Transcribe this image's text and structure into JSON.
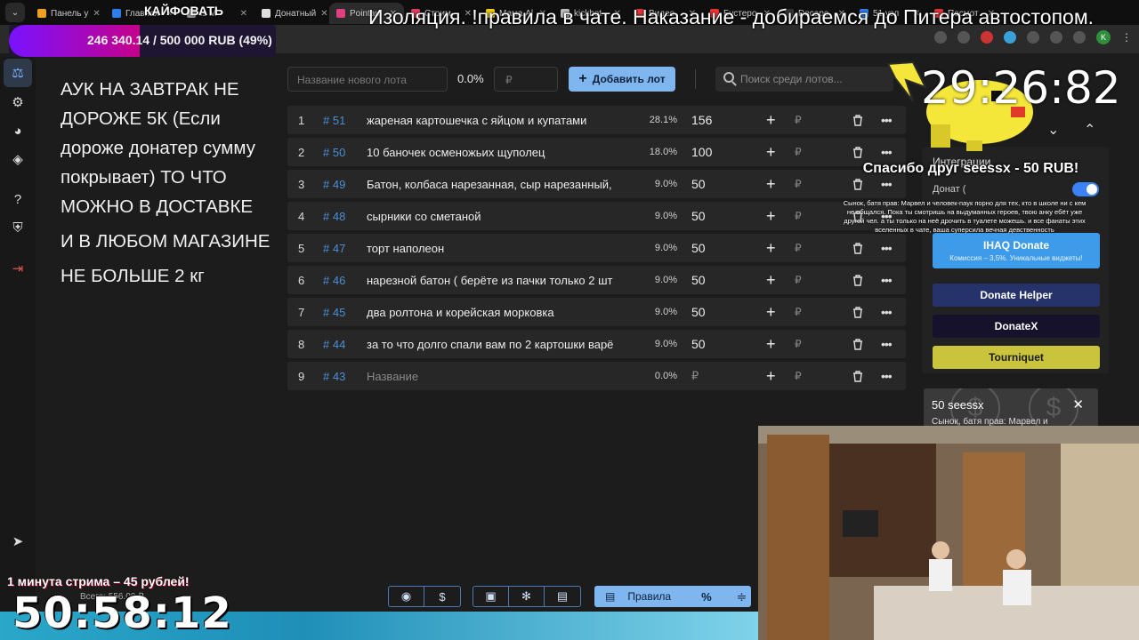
{
  "tabs": [
    {
      "label": "Панель у",
      "color": "#f0a020"
    },
    {
      "label": "Главная",
      "color": "#2b7de9"
    },
    {
      "label": "is M",
      "color": "#999999"
    },
    {
      "label": "Донатный",
      "color": "#dddddd"
    },
    {
      "label": "Pointau",
      "color": "#e04080",
      "active": true
    },
    {
      "label": "Стрим",
      "color": "#e33b5a"
    },
    {
      "label": "Мама Аl",
      "color": "#f2c811"
    },
    {
      "label": "kickbot",
      "color": "#bbbbbb"
    },
    {
      "label": "Видео",
      "color": "#d33"
    },
    {
      "label": "Бустеро",
      "color": "#e33"
    },
    {
      "label": "Decapo",
      "color": "#333"
    },
    {
      "label": "51 узл",
      "color": "#2b7de9"
    },
    {
      "label": "Посмот",
      "color": "#d33"
    }
  ],
  "overlay": {
    "marquee": "Изоляция. !правила в чате. Наказание - добираемся до Питера автостопом.",
    "kaif": "КАЙФОВАТЬ",
    "progress_text": "246 340.14 / 500 000 RUB (49%)",
    "progress_fraction": 0.49,
    "minute_promo": "1 минута стрима – 45 рублей!",
    "total": "Всего: 556.00 ₽",
    "big_clock": "50:58:12"
  },
  "rules_text": [
    "АУК НА ЗАВТРАК НЕ ДОРОЖЕ 5К (Если дороже донатер сумму покрывает) ТО ЧТО МОЖНО В ДОСТАВКЕ",
    "И В ЛЮБОМ МАГАЗИНЕ",
    "НЕ БОЛЬШЕ 2 кг"
  ],
  "controls": {
    "lot_placeholder": "Название нового лота",
    "percent": "0.0%",
    "rub_placeholder": "₽",
    "add_label": "Добавить лот",
    "search_placeholder": "Поиск среди лотов..."
  },
  "lots": [
    {
      "idx": "1",
      "tag": "# 51",
      "name": "жареная картошечка с яйцом и купатами",
      "perc": "28.1%",
      "amount": "156"
    },
    {
      "idx": "2",
      "tag": "# 50",
      "name": "10 баночек осменожьих щуполец",
      "perc": "18.0%",
      "amount": "100"
    },
    {
      "idx": "3",
      "tag": "# 49",
      "name": "Батон, колбаса нарезанная, сыр нарезанный,",
      "perc": "9.0%",
      "amount": "50"
    },
    {
      "idx": "4",
      "tag": "# 48",
      "name": "сырники со сметаной",
      "perc": "9.0%",
      "amount": "50"
    },
    {
      "idx": "5",
      "tag": "# 47",
      "name": "торт наполеон",
      "perc": "9.0%",
      "amount": "50"
    },
    {
      "idx": "6",
      "tag": "# 46",
      "name": "нарезной батон ( берёте из пачки только 2 шт",
      "perc": "9.0%",
      "amount": "50"
    },
    {
      "idx": "7",
      "tag": "# 45",
      "name": "два ролтона и корейская морковка",
      "perc": "9.0%",
      "amount": "50"
    },
    {
      "idx": "8",
      "tag": "# 44",
      "name": "за то что долго спали вам по 2 картошки варё",
      "perc": "9.0%",
      "amount": "50"
    },
    {
      "idx": "9",
      "tag": "# 43",
      "name": "Название",
      "perc": "0.0%",
      "amount": "₽",
      "placeholder": true
    }
  ],
  "row_glyphs": {
    "plus": "+",
    "rub": "₽",
    "more": "•••"
  },
  "right": {
    "timer": "29:26:82",
    "integrations_label": "Интеграции",
    "donate_label": "Донат (",
    "thanks": "Спасибо друг seessx - 50 RUB!",
    "donor_message": "Сынок, батя прав: Марвел и человек-паук порно для тех, кто в школе ни с кем не общался. Пока ты смотришь на выдуманных героев, твою анку ебёт уже другой чел. а ты только на неё дрочить в туалете можешь. и все фанаты этих вселенных в чате, ваша суперсила вечная девственность",
    "services": [
      {
        "title": "IHAQ Donate",
        "sub": "Комиссия – 3,5%. Уникальные виджеты!",
        "color": "#3d9be9"
      },
      {
        "title": "Donate Helper",
        "sub": "",
        "color": "#25336a"
      },
      {
        "title": "DonateX",
        "sub": "",
        "color": "#16122b"
      },
      {
        "title": "Tourniquet",
        "sub": "",
        "color": "#c9c43c"
      }
    ],
    "alert_title": "50 seessx",
    "alert_text": "Сынок, батя прав: Марвел и"
  },
  "toolbar": {
    "rules_label": "Правила",
    "percent_icon": "%"
  }
}
